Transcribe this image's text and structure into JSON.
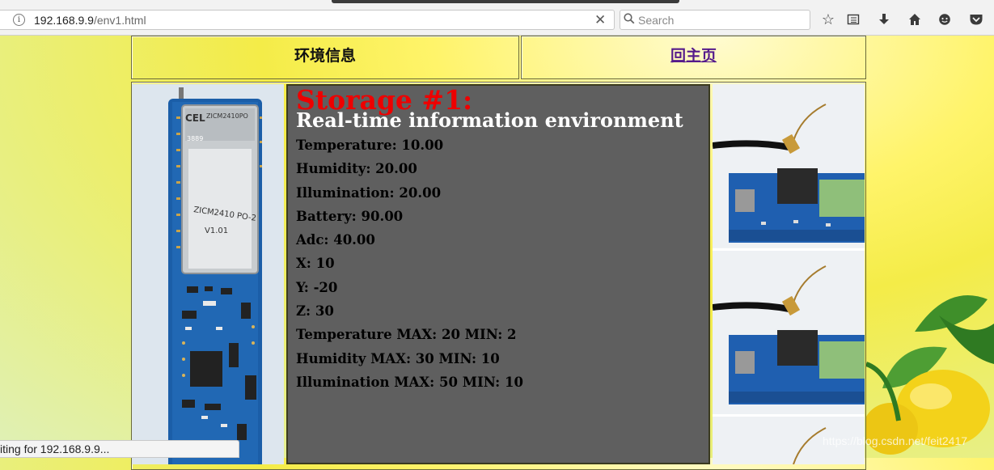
{
  "browser": {
    "url_host": "192.168.9.9",
    "url_path": "/env1.html",
    "search_placeholder": "Search",
    "status_text": "iting for 192.168.9.9..."
  },
  "nav": {
    "title": "环境信息",
    "home_link": "回主页"
  },
  "info": {
    "storage_heading": "Storage #1:",
    "subheading": "Real-time information environment",
    "readings": [
      "Temperature: 10.00",
      "Humidity: 20.00",
      "Illumination: 20.00",
      "Battery: 90.00",
      "Adc: 40.00",
      "X: 10",
      "Y: -20",
      "Z: 30",
      "Temperature MAX: 20 MIN: 2",
      "Humidity MAX: 30 MIN: 10",
      "Illumination MAX: 50 MIN: 10"
    ]
  },
  "module_labels": {
    "logo": "CEL",
    "model": "ZICM2410PO",
    "chip_label": "ZICM2410 PO-2",
    "version": "V1.01",
    "code": "3889"
  },
  "watermark": "https://blog.csdn.net/feit2417",
  "colors": {
    "heading": "#ee0000",
    "subheading": "#ffffff",
    "info_bg": "#5f5f5f",
    "link": "#551a8b"
  }
}
